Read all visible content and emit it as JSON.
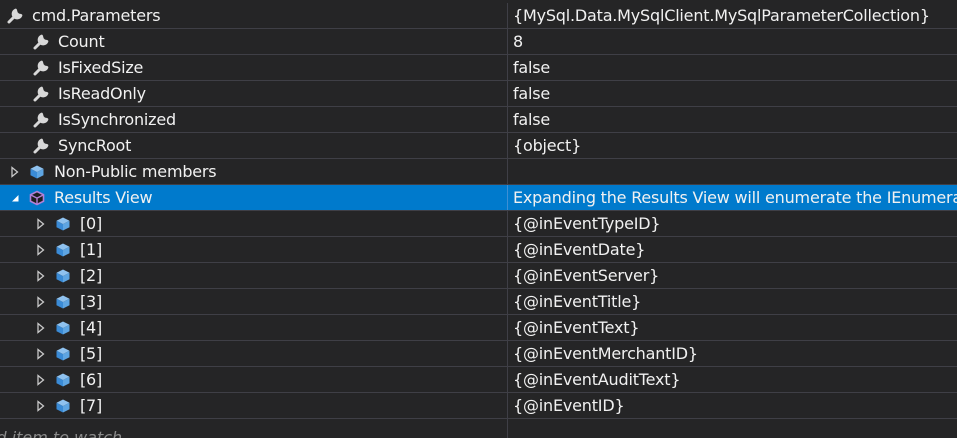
{
  "colors": {
    "background": "#252526",
    "grid_line": "#3f3f46",
    "selection": "#007acc",
    "text": "#f1f1f1",
    "placeholder": "#8a8a8a",
    "object_icon": "#5ea5e2",
    "results_icon": "#b180d7"
  },
  "rows": [
    {
      "name": "cmd.Parameters",
      "value": "{MySql.Data.MySqlClient.MySqlParameterCollection}",
      "icon": "wrench-icon",
      "expander": "none"
    },
    {
      "name": "Count",
      "value": "8",
      "icon": "wrench-icon",
      "expander": "none"
    },
    {
      "name": "IsFixedSize",
      "value": "false",
      "icon": "wrench-icon",
      "expander": "none"
    },
    {
      "name": "IsReadOnly",
      "value": "false",
      "icon": "wrench-icon",
      "expander": "none"
    },
    {
      "name": "IsSynchronized",
      "value": "false",
      "icon": "wrench-icon",
      "expander": "none"
    },
    {
      "name": "SyncRoot",
      "value": "{object}",
      "icon": "wrench-icon",
      "expander": "none"
    },
    {
      "name": "Non-Public members",
      "value": "",
      "icon": "object-icon",
      "expander": "collapsed"
    },
    {
      "name": "Results View",
      "value": "Expanding the Results View will enumerate the IEnumera",
      "icon": "results-view-icon",
      "expander": "expanded"
    },
    {
      "name": "[0]",
      "value": "{@inEventTypeID}",
      "icon": "object-icon",
      "expander": "collapsed"
    },
    {
      "name": "[1]",
      "value": "{@inEventDate}",
      "icon": "object-icon",
      "expander": "collapsed"
    },
    {
      "name": "[2]",
      "value": "{@inEventServer}",
      "icon": "object-icon",
      "expander": "collapsed"
    },
    {
      "name": "[3]",
      "value": "{@inEventTitle}",
      "icon": "object-icon",
      "expander": "collapsed"
    },
    {
      "name": "[4]",
      "value": "{@inEventText}",
      "icon": "object-icon",
      "expander": "collapsed"
    },
    {
      "name": "[5]",
      "value": "{@inEventMerchantID}",
      "icon": "object-icon",
      "expander": "collapsed"
    },
    {
      "name": "[6]",
      "value": "{@inEventAuditText}",
      "icon": "object-icon",
      "expander": "collapsed"
    },
    {
      "name": "[7]",
      "value": "{@inEventID}",
      "icon": "object-icon",
      "expander": "collapsed"
    }
  ],
  "add_watch_placeholder": "ld item to watch"
}
